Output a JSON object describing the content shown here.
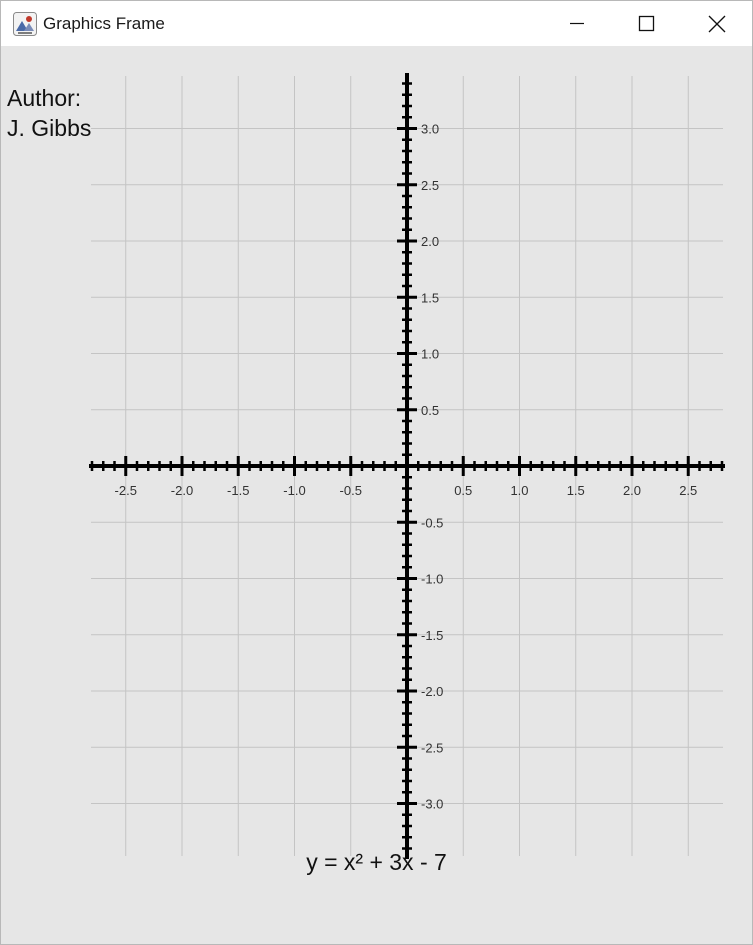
{
  "window": {
    "title": "Graphics Frame",
    "controls": {
      "minimize": "minimize-icon",
      "maximize": "maximize-icon",
      "close": "close-icon"
    }
  },
  "author": {
    "label": "Author:",
    "name": "J. Gibbs"
  },
  "equation": "y = x² + 3x - 7",
  "chart_data": {
    "type": "line",
    "title": "",
    "xlabel": "",
    "ylabel": "",
    "xlim": [
      -2.8,
      2.8
    ],
    "ylim": [
      -3.5,
      3.5
    ],
    "grid": true,
    "x_ticks": [
      "-2.5",
      "-2.0",
      "-1.5",
      "-1.0",
      "-0.5",
      "0.5",
      "1.0",
      "1.5",
      "2.0",
      "2.5"
    ],
    "y_ticks": [
      "3.0",
      "2.5",
      "2.0",
      "1.5",
      "1.0",
      "0.5",
      "-0.5",
      "-1.0",
      "-1.5",
      "-2.0",
      "-2.5",
      "-3.0"
    ],
    "series": [],
    "colors": {
      "axis": "#000000",
      "grid": "#c4c4c4",
      "background": "#e6e6e6"
    }
  }
}
